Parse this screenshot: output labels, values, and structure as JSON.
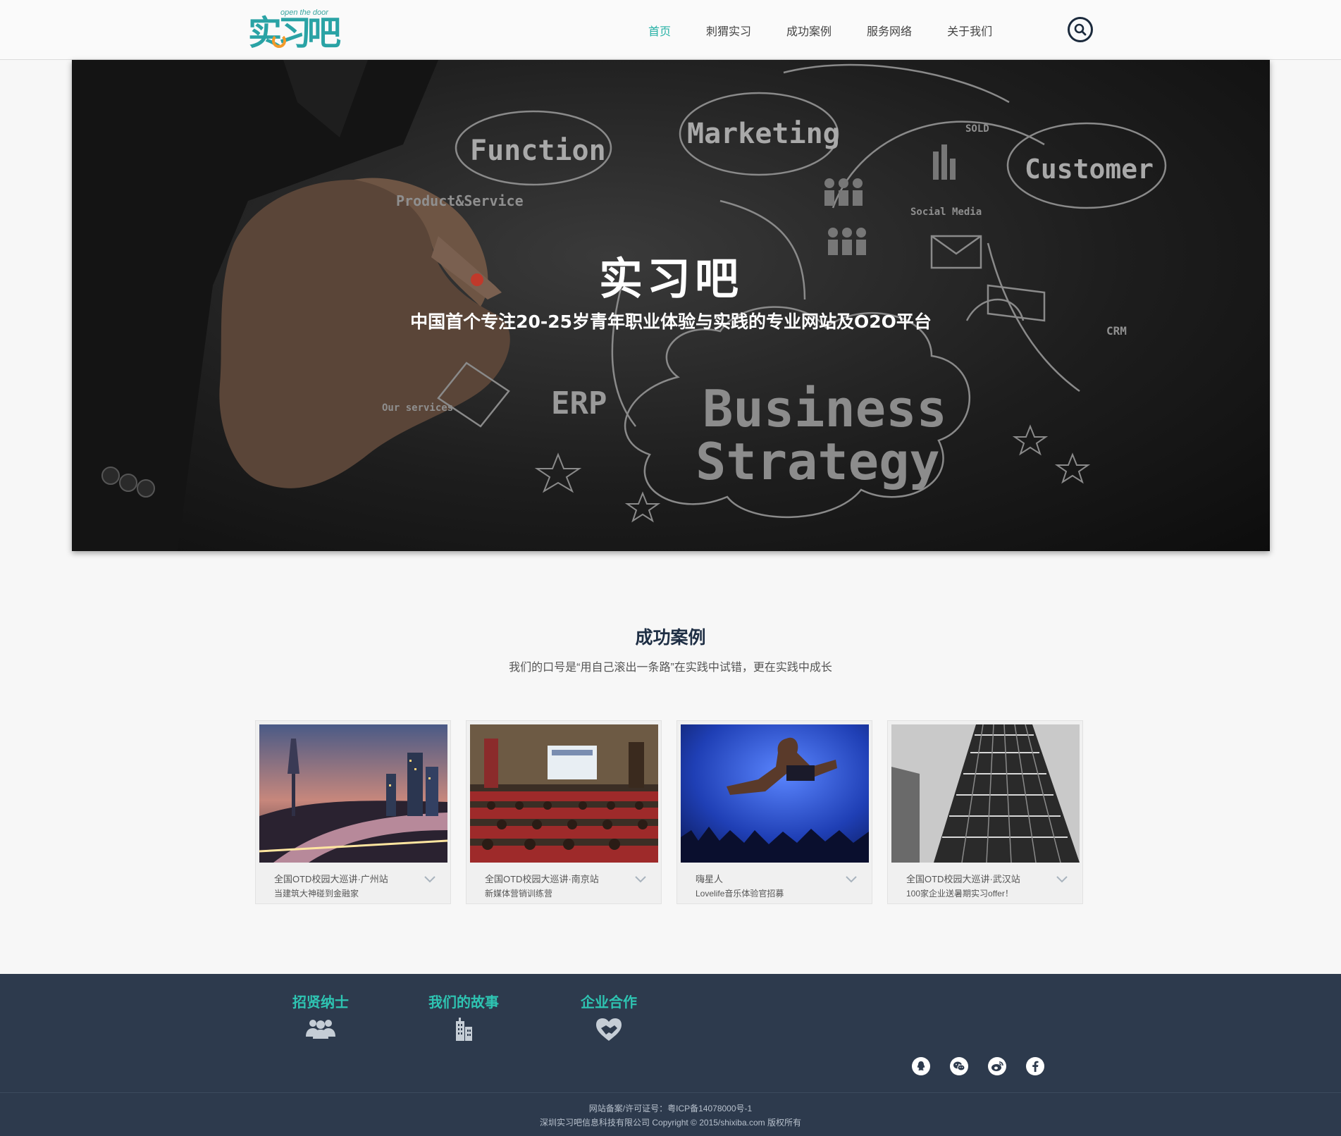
{
  "header": {
    "logo_text": "实习吧",
    "logo_sub": "open the door",
    "nav": [
      {
        "label": "首页",
        "active": true
      },
      {
        "label": "刺猬实习",
        "active": false
      },
      {
        "label": "成功案例",
        "active": false
      },
      {
        "label": "服务网络",
        "active": false
      },
      {
        "label": "关于我们",
        "active": false
      }
    ]
  },
  "hero": {
    "title": "实习吧",
    "subtitle": "中国首个专注20-25岁青年职业体验与实践的专业网站及O2O平台",
    "sketch_words": [
      "Function",
      "Marketing",
      "Customer",
      "Product&Service",
      "ERP",
      "Business",
      "Strategy",
      "Social Media",
      "SOLD",
      "CRM"
    ]
  },
  "cases": {
    "title": "成功案例",
    "subtitle": "我们的口号是“用自己滚出一条路”在实践中试错，更在实践中成长",
    "items": [
      {
        "title": "全国OTD校园大巡讲·广州站",
        "desc": "当建筑大神碰到金融家"
      },
      {
        "title": "全国OTD校园大巡讲·南京站",
        "desc": "新媒体营销训练营"
      },
      {
        "title": "嗨星人",
        "desc": "Lovelife音乐体验官招募"
      },
      {
        "title": "全国OTD校园大巡讲·武汉站",
        "desc": "100家企业送暑期实习offer！"
      }
    ]
  },
  "footer": {
    "columns": [
      {
        "title": "招贤纳士",
        "icon": "people-icon"
      },
      {
        "title": "我们的故事",
        "icon": "building-icon"
      },
      {
        "title": "企业合作",
        "icon": "handshake-heart-icon"
      }
    ],
    "social": [
      "qq-icon",
      "wechat-icon",
      "weibo-icon",
      "facebook-icon"
    ],
    "icp": "网站备案/许可证号：粤ICP备14078000号-1",
    "copyright": "深圳实习吧信息科技有限公司 Copyright © 2015/shixiba.com 版权所有"
  },
  "colors": {
    "accent": "#27b1a6",
    "footer_bg": "#2d3a4d",
    "footer_title": "#2ec4b2",
    "logo_orange": "#f39a2a"
  }
}
